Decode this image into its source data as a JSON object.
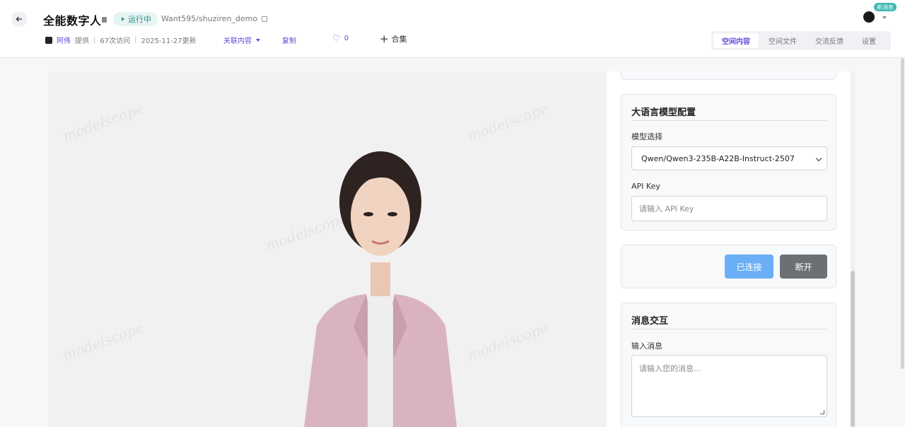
{
  "header": {
    "title": "全能数字人",
    "status": "运行中",
    "repo": "Want595/shuziren_demo",
    "author": "阿伟",
    "provided": "提供",
    "visits": "67次访问",
    "updated": "2025-11-27更新",
    "related": "关联内容",
    "copy": "复制",
    "likes": "0",
    "collection": "合集",
    "tabs": [
      "空间内容",
      "空间文件",
      "交流反馈",
      "设置"
    ],
    "new_badge": "新消息"
  },
  "video": {
    "watermark": "modelscope"
  },
  "panel": {
    "llm": {
      "title": "大语言模型配置",
      "model_label": "模型选择",
      "model_value": "Qwen/Qwen3-235B-A22B-Instruct-2507",
      "apikey_label": "API Key",
      "apikey_placeholder": "请输入 API Key"
    },
    "connection": {
      "connected_label": "已连接",
      "disconnect_label": "断开"
    },
    "message": {
      "title": "消息交互",
      "input_label": "输入消息",
      "input_placeholder": "请输入您的消息..."
    }
  },
  "colors": {
    "accent": "#5b4bd8",
    "status": "#2a8f86",
    "connected": "#6aaef5",
    "disconnect": "#6b7075"
  }
}
